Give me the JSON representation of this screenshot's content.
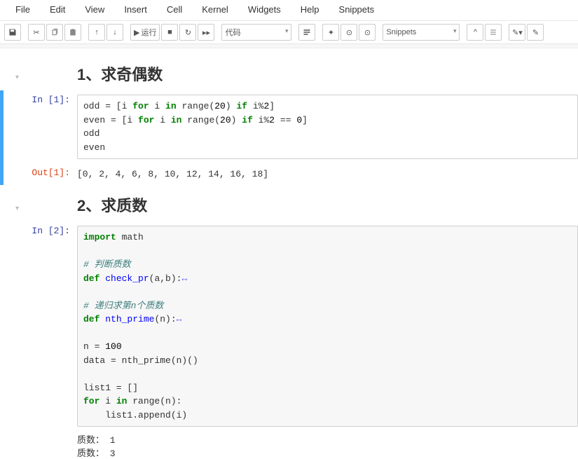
{
  "menu": [
    "File",
    "Edit",
    "View",
    "Insert",
    "Cell",
    "Kernel",
    "Widgets",
    "Help",
    "Snippets"
  ],
  "toolbar": {
    "run_label": "运行",
    "celltype": "代码",
    "snippets": "Snippets"
  },
  "cells": {
    "h1": "1、求奇偶数",
    "in1_prompt": "In  [1]:",
    "in1_code": {
      "l1a": "odd = [i ",
      "l1b": "for",
      "l1c": " i ",
      "l1d": "in",
      "l1e": " range(",
      "l1f": "20",
      "l1g": ") ",
      "l1h": "if",
      "l1i": " i%",
      "l1j": "2",
      "l1k": "]",
      "l2a": "even = [i ",
      "l2b": "for",
      "l2c": " i ",
      "l2d": "in",
      "l2e": " range(",
      "l2f": "20",
      "l2g": ") ",
      "l2h": "if",
      "l2i": " i%",
      "l2j": "2",
      "l2k": " == ",
      "l2l": "0",
      "l2m": "]",
      "l3": "odd",
      "l4": "even"
    },
    "out1_prompt": "Out[1]:",
    "out1": "[0, 2, 4, 6, 8, 10, 12, 14, 16, 18]",
    "h2": "2、求质数",
    "in2_prompt": "In  [2]:",
    "in2_code": {
      "l1a": "import",
      "l1b": " math",
      "c1": "# 判断质数",
      "d1a": "def",
      "d1b": " ",
      "d1c": "check_pr",
      "d1d": "(a,b):",
      "d1e": "↔",
      "c2": "# 递归求第n个质数",
      "d2a": "def",
      "d2b": " ",
      "d2c": "nth_prime",
      "d2d": "(n):",
      "d2e": "↔",
      "l5a": "n = ",
      "l5b": "100",
      "l6": "data = nth_prime(n)()",
      "l7": "list1 = []",
      "l8a": "for",
      "l8b": " i ",
      "l8c": "in",
      "l8d": " range(n):",
      "l9": "    list1.append(i)"
    },
    "stream": "质数： 1\n质数： 3"
  },
  "chart_data": null
}
